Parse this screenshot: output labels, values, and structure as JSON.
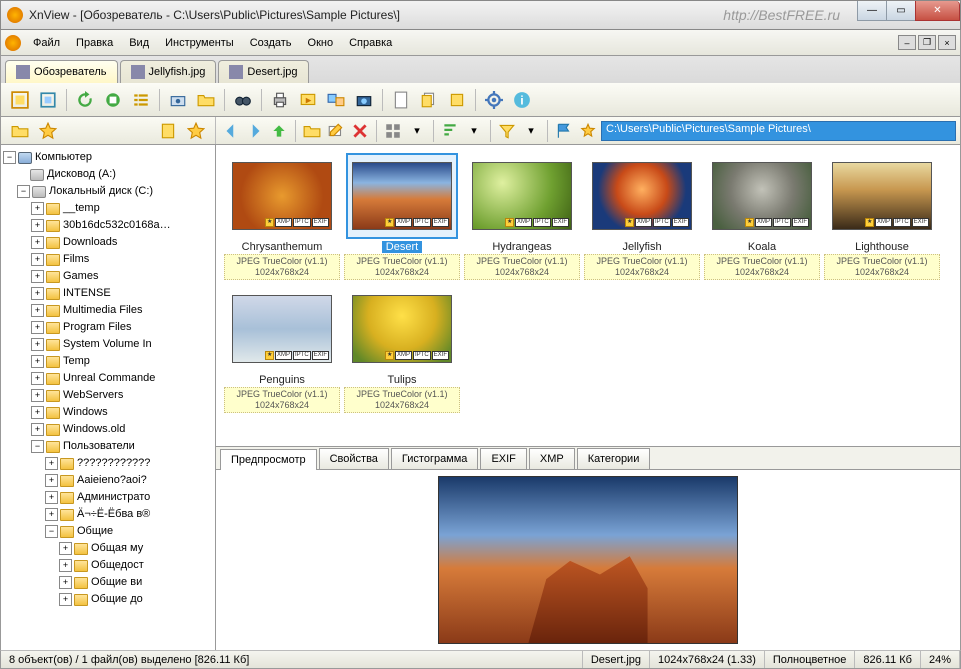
{
  "window": {
    "title": "XnView - [Обозреватель - C:\\Users\\Public\\Pictures\\Sample Pictures\\]",
    "watermark": "http://BestFREE.ru"
  },
  "menu": {
    "items": [
      "Файл",
      "Правка",
      "Вид",
      "Инструменты",
      "Создать",
      "Окно",
      "Справка"
    ]
  },
  "tabs": [
    {
      "label": "Обозреватель",
      "active": true
    },
    {
      "label": "Jellyfish.jpg",
      "active": false
    },
    {
      "label": "Desert.jpg",
      "active": false
    }
  ],
  "address": "C:\\Users\\Public\\Pictures\\Sample Pictures\\",
  "tree": {
    "root": "Компьютер",
    "drives": [
      {
        "label": "Дисковод (A:)",
        "type": "drive",
        "expandable": false
      },
      {
        "label": "Локальный диск (C:)",
        "type": "drive",
        "expandable": true,
        "expanded": true,
        "children": [
          "__temp",
          "30b16dc532c0168a…",
          "Downloads",
          "Films",
          "Games",
          "INTENSE",
          "Multimedia Files",
          "Program Files",
          "System Volume In",
          "Temp",
          "Unreal Commande",
          "WebServers",
          "Windows",
          "Windows.old",
          {
            "label": "Пользователи",
            "expanded": true,
            "children": [
              "????????????",
              "Aaieieno?aoi?",
              "Администрато",
              "Ä¬÷Ё-Ёбва в®",
              {
                "label": "Общие",
                "expanded": true,
                "children": [
                  "Общая му",
                  "Общедост",
                  "Общие ви",
                  "Общие до"
                ]
              }
            ]
          }
        ]
      }
    ]
  },
  "thumbnails": [
    {
      "name": "Chrysanthemum",
      "cls": "chrys",
      "format": "JPEG TrueColor (v1.1)",
      "dims": "1024x768x24",
      "selected": false
    },
    {
      "name": "Desert",
      "cls": "desert",
      "format": "JPEG TrueColor (v1.1)",
      "dims": "1024x768x24",
      "selected": true
    },
    {
      "name": "Hydrangeas",
      "cls": "hydra",
      "format": "JPEG TrueColor (v1.1)",
      "dims": "1024x768x24",
      "selected": false
    },
    {
      "name": "Jellyfish",
      "cls": "jelly",
      "format": "JPEG TrueColor (v1.1)",
      "dims": "1024x768x24",
      "selected": false
    },
    {
      "name": "Koala",
      "cls": "koala",
      "format": "JPEG TrueColor (v1.1)",
      "dims": "1024x768x24",
      "selected": false
    },
    {
      "name": "Lighthouse",
      "cls": "light",
      "format": "JPEG TrueColor (v1.1)",
      "dims": "1024x768x24",
      "selected": false
    },
    {
      "name": "Penguins",
      "cls": "peng",
      "format": "JPEG TrueColor (v1.1)",
      "dims": "1024x768x24",
      "selected": false
    },
    {
      "name": "Tulips",
      "cls": "tulip",
      "format": "JPEG TrueColor (v1.1)",
      "dims": "1024x768x24",
      "selected": false
    }
  ],
  "thumb_badges": [
    "XMP",
    "IPTC",
    "EXIF"
  ],
  "preview_tabs": [
    "Предпросмотр",
    "Свойства",
    "Гистограмма",
    "EXIF",
    "XMP",
    "Категории"
  ],
  "preview_active": 0,
  "status": {
    "count": "8 объект(ов) / 1 файл(ов) выделено    [826.11 Кб]",
    "file": "Desert.jpg",
    "dims": "1024x768x24 (1.33)",
    "color": "Полноцветное",
    "size": "826.11 Кб",
    "zoom": "24%"
  }
}
